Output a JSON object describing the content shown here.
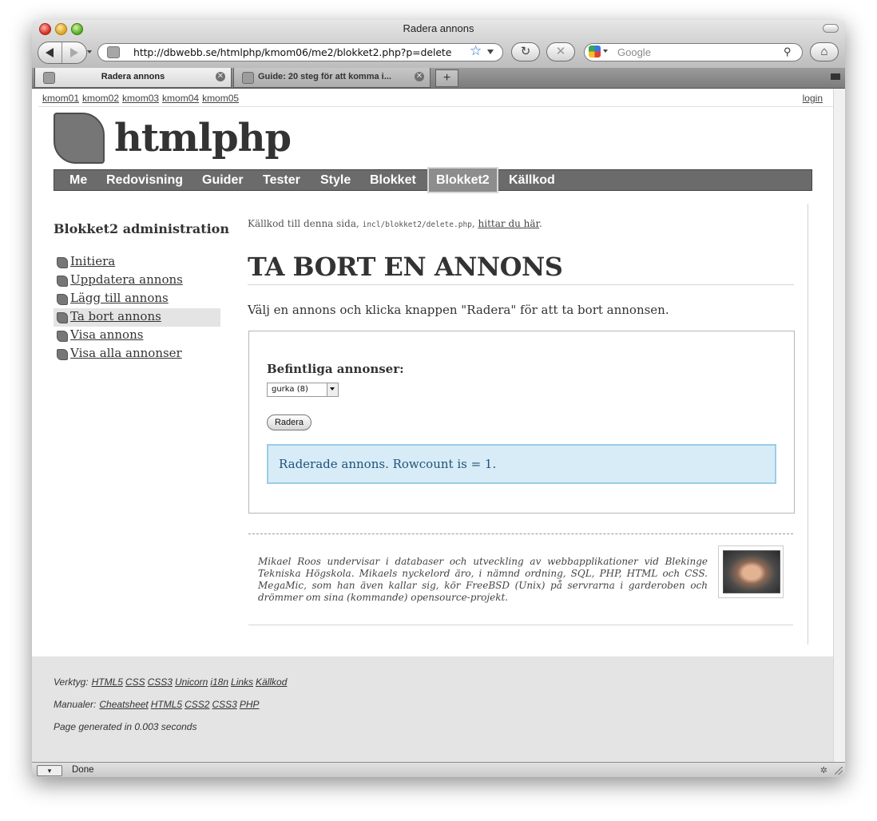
{
  "window": {
    "title": "Radera annons"
  },
  "toolbar": {
    "url": "http://dbwebb.se/htmlphp/kmom06/me2/blokket2.php?p=delete",
    "search_placeholder": "Google",
    "reload_glyph": "↻",
    "stop_glyph": "✕",
    "home_glyph": "⌂",
    "star_glyph": "☆",
    "magnifier_glyph": "⚲"
  },
  "tabs": [
    {
      "label": "Radera annons",
      "active": true
    },
    {
      "label": "Guide: 20 steg för att komma i...",
      "active": false
    }
  ],
  "newtab_label": "+",
  "tab_close_glyph": "✕",
  "topnav": {
    "links": [
      "kmom01",
      "kmom02",
      "kmom03",
      "kmom04",
      "kmom05"
    ],
    "login": "login"
  },
  "site": {
    "name": "htmlphp"
  },
  "mainnav": {
    "items": [
      "Me",
      "Redovisning",
      "Guider",
      "Tester",
      "Style",
      "Blokket",
      "Blokket2",
      "Källkod"
    ],
    "selected": "Blokket2"
  },
  "sidebar": {
    "title": "Blokket2 administration",
    "items": [
      {
        "label": "Initiera"
      },
      {
        "label": "Uppdatera annons"
      },
      {
        "label": "Lägg till annons"
      },
      {
        "label": "Ta bort annons",
        "current": true
      },
      {
        "label": "Visa annons"
      },
      {
        "label": "Visa alla annonser"
      }
    ]
  },
  "main": {
    "source_prefix": "Källkod till denna sida, ",
    "source_file": "incl/blokket2/delete.php",
    "source_sep": ", ",
    "source_link": "hittar du här",
    "source_end": ".",
    "heading": "TA BORT EN ANNONS",
    "intro": "Välj en annons och klicka knappen \"Radera\" för att ta bort annonsen.",
    "form": {
      "label": "Befintliga annonser:",
      "selected_option": "gurka (8)",
      "button": "Radera",
      "notice": "Raderade annons. Rowcount is = 1."
    },
    "byline": "Mikael Roos undervisar i databaser och utveckling av webbapplikationer vid Blekinge Tekniska Högskola. Mikaels nyckelord äro, i nämnd ordning, SQL, PHP, HTML och CSS. MegaMic, som han även kallar sig, kör FreeBSD (Unix) på servrarna i garderoben och drömmer om sina (kommande) opensource-projekt."
  },
  "footer": {
    "tools_label": "Verktyg:",
    "tools": [
      "HTML5",
      "CSS",
      "CSS3",
      "Unicorn",
      "i18n",
      "Links",
      "Källkod"
    ],
    "manuals_label": "Manualer:",
    "manuals": [
      "Cheatsheet",
      "HTML5",
      "CSS2",
      "CSS3",
      "PHP"
    ],
    "generated": "Page generated in 0.003 seconds"
  },
  "status": {
    "text": "Done"
  },
  "colors": {
    "notice_bg": "#d7ecf7",
    "notice_border": "#9acde6",
    "nav_bg": "#6b6b6b",
    "footer_bg": "#e4e4e4"
  }
}
